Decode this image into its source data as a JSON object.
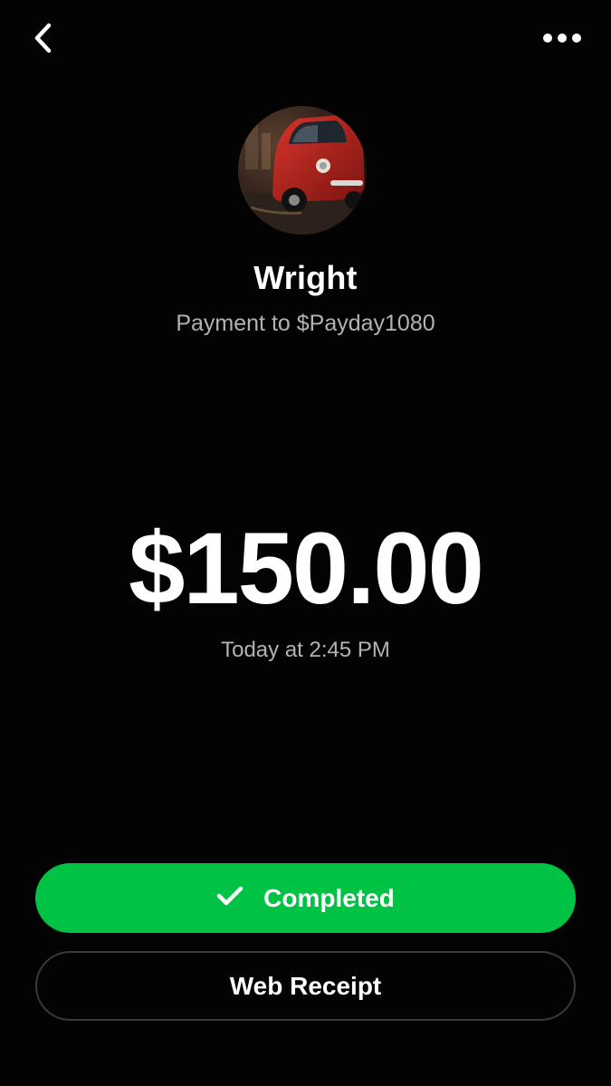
{
  "header": {
    "back_icon": "chevron-left-icon",
    "more_icon": "more-horizontal-icon"
  },
  "recipient": {
    "avatar_description_icon": "avatar-image",
    "name": "Wright",
    "subtitle": "Payment to $Payday1080"
  },
  "payment": {
    "amount": "$150.00",
    "timestamp": "Today at 2:45 PM"
  },
  "actions": {
    "status_label": "Completed",
    "status_icon": "checkmark-icon",
    "receipt_label": "Web Receipt"
  },
  "colors": {
    "background": "#030303",
    "accent_green": "#00C244",
    "secondary_text": "#b3b3b3",
    "outline": "#3a3a3a"
  }
}
